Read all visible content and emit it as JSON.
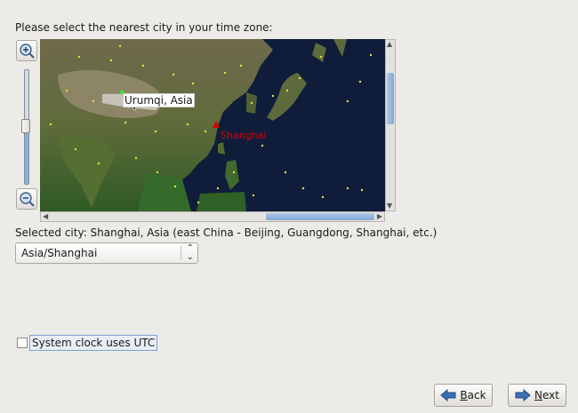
{
  "prompt": "Please select the nearest city in your time zone:",
  "map": {
    "hover_label": "Urumqi, Asia",
    "selected_label": "Shanghai"
  },
  "selected_city_text": "Selected city: Shanghai, Asia (east China - Beijing, Guangdong, Shanghai, etc.)",
  "timezone_select": {
    "value": "Asia/Shanghai"
  },
  "utc_checkbox": {
    "label": "System clock uses UTC",
    "checked": false
  },
  "buttons": {
    "back": {
      "label": "Back",
      "mnemonic": "B",
      "rest": "ack"
    },
    "next": {
      "label": "Next",
      "mnemonic": "N",
      "rest": "ext"
    }
  },
  "colors": {
    "selected_city": "#d80000",
    "city_dot": "#e8e23a",
    "scroll_thumb": "#8fb0d6"
  }
}
